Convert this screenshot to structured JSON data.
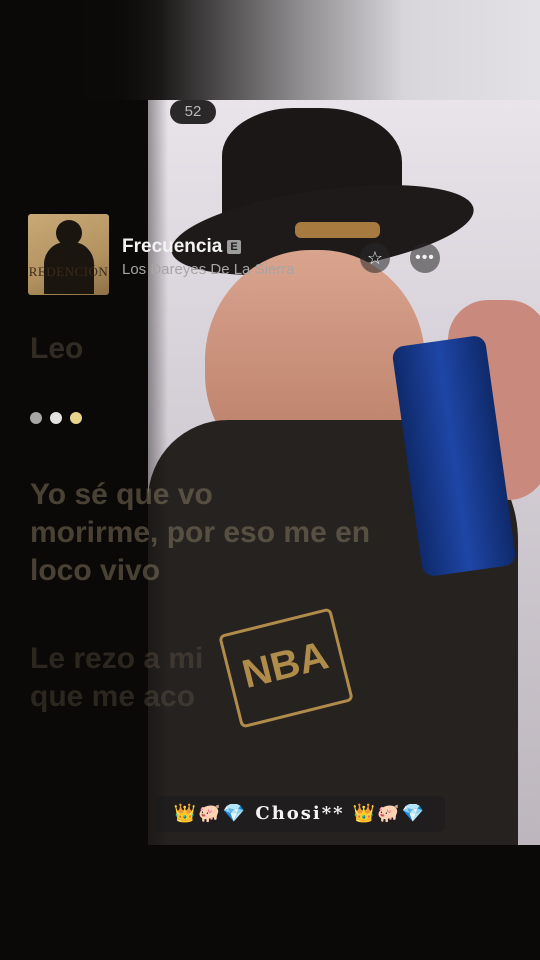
{
  "status_badge": "52",
  "now_playing": {
    "album_art_text": "REDENCIÓN",
    "title": "Frecuencia",
    "explicit_label": "E",
    "artist": "Los Dareyes De La Sierra",
    "favorite_icon": "star-icon",
    "more_icon": "ellipsis-icon"
  },
  "lyrics": {
    "previous_line": "Leo",
    "current_lines": [
      "Yo sé que vo",
      "morirme, por eso me en",
      "loco vivo"
    ],
    "next_lines": [
      "Le rezo a mi",
      "que me aco"
    ]
  },
  "dot_colors": [
    "#a9a7a3",
    "#e5e3df",
    "#e7d58e"
  ],
  "caption": "👑🐖💎 Chosi** 👑🐖💎",
  "colors": {
    "background": "#0b0907",
    "title": "#f2f2f2",
    "artist": "#a7a5a3"
  }
}
